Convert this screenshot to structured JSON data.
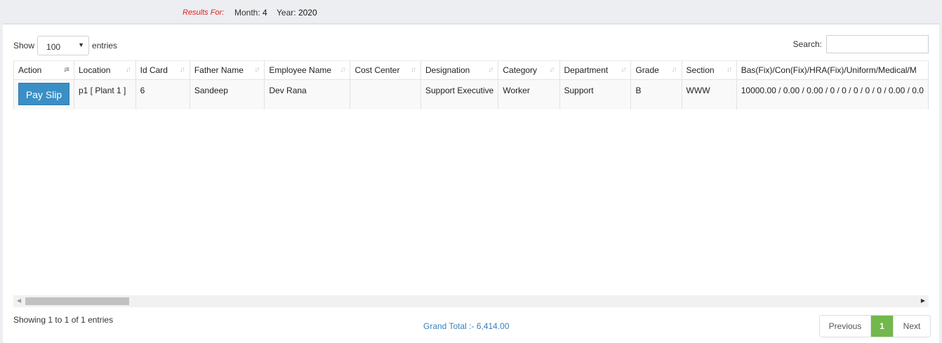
{
  "header": {
    "results_for": "Results For:",
    "month_label": "Month:",
    "month_value": "4",
    "year_label": "Year:",
    "year_value": "2020"
  },
  "controls": {
    "show_label": "Show",
    "entries_value": "100",
    "entries_label": "entries",
    "search_label": "Search:",
    "search_value": ""
  },
  "table": {
    "columns": [
      "Action",
      "Location",
      "Id Card",
      "Father Name",
      "Employee Name",
      "Cost Center",
      "Designation",
      "Category",
      "Department",
      "Grade",
      "Section",
      "Bas(Fix)/Con(Fix)/HRA(Fix)/Uniform/Medical/M"
    ],
    "rows": [
      {
        "action": "Pay Slip",
        "location": "p1 [ Plant 1 ]",
        "id_card": "6",
        "father_name": "Sandeep",
        "employee_name": "Dev Rana",
        "cost_center": "",
        "designation": "Support Executive",
        "category": "Worker",
        "department": "Support",
        "grade": "B",
        "section": "WWW",
        "salary": "10000.00 / 0.00 / 0.00 / 0 / 0 / 0 / 0 / 0 / 0.00 / 0.0"
      }
    ]
  },
  "footer": {
    "info": "Showing 1 to 1 of 1 entries",
    "grand_total": "Grand Total :- 6,414.00",
    "previous": "Previous",
    "current_page": "1",
    "next": "Next"
  },
  "colors": {
    "accent_button": "#3a8fc6",
    "active_page": "#72b84c",
    "results_for": "#e02020",
    "grand_total": "#3a7fb8"
  }
}
